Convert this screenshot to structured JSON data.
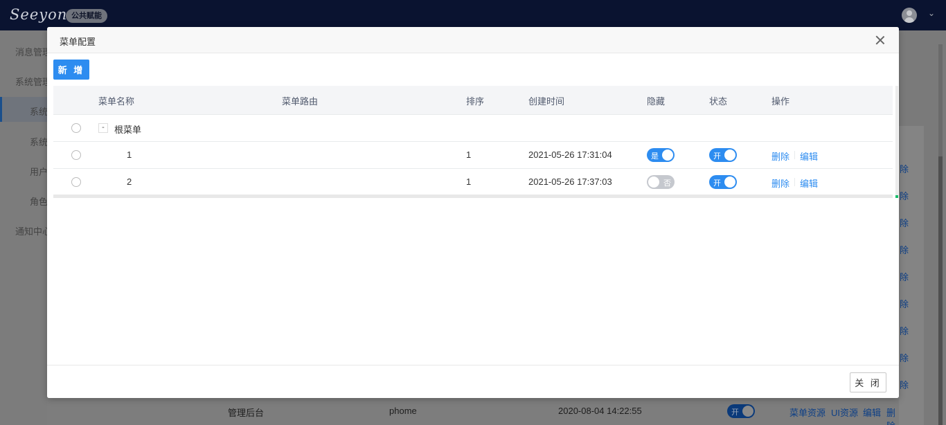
{
  "app": {
    "logo_text": "Seeyon",
    "badge": "公共赋能"
  },
  "sidebar": {
    "items": [
      {
        "label": "消息管理"
      },
      {
        "label": "系统管理"
      },
      {
        "label": "系统"
      },
      {
        "label": "系统"
      },
      {
        "label": "用户"
      },
      {
        "label": "角色"
      },
      {
        "label": "通知中心"
      }
    ]
  },
  "background": {
    "row_links": [
      "除",
      "除",
      "除",
      "除",
      "除",
      "除",
      "除",
      "除",
      "除"
    ],
    "bottom_row": {
      "name": "管理后台",
      "route": "phome",
      "time": "2020-08-04 14:22:55",
      "toggle": "开",
      "actions": [
        "菜单资源",
        "UI资源",
        "编辑",
        "删除"
      ]
    }
  },
  "modal": {
    "title": "菜单配置",
    "add_button": "新 增",
    "close_button": "关 闭",
    "columns": [
      "菜单名称",
      "菜单路由",
      "排序",
      "创建时间",
      "隐藏",
      "状态",
      "操作"
    ],
    "root": {
      "expander": "-",
      "name": "根菜单"
    },
    "rows": [
      {
        "name": "1",
        "route": "",
        "order": "1",
        "created": "2021-05-26 17:31:04",
        "hidden": "是",
        "hidden_on": true,
        "status": "开",
        "status_on": true,
        "delete": "删除",
        "edit": "编辑"
      },
      {
        "name": "2",
        "route": "",
        "order": "1",
        "created": "2021-05-26 17:37:03",
        "hidden": "否",
        "hidden_on": false,
        "status": "开",
        "status_on": true,
        "delete": "删除",
        "edit": "编辑"
      }
    ]
  },
  "colors": {
    "primary": "#2d8cf0",
    "topbar": "#0a1330",
    "toggle_off": "#c5c8ce"
  }
}
